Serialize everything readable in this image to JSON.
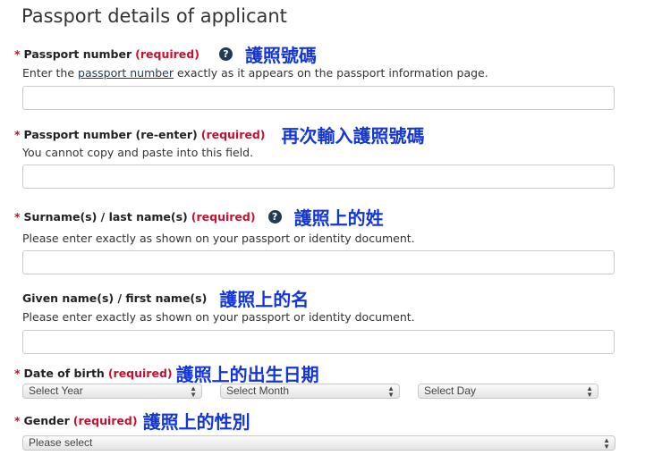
{
  "title": "Passport details of applicant",
  "required_text": "(required)",
  "asterisk": "*",
  "fields": [
    {
      "label": "Passport number",
      "annotation": "護照號碼",
      "hint_before": "Enter the ",
      "hint_link": "passport number",
      "hint_after": " exactly as it appears on the passport information page."
    },
    {
      "label": "Passport number (re-enter)",
      "annotation": "再次輸入護照號碼",
      "hint": "You cannot copy and paste into this field."
    },
    {
      "label": "Surname(s) / last name(s)",
      "annotation": "護照上的姓",
      "hint": "Please enter exactly as shown on your passport or identity document."
    },
    {
      "label": "Given name(s) / first name(s)",
      "annotation": "護照上的名",
      "hint": "Please enter exactly as shown on your passport or identity document."
    },
    {
      "label": "Date of birth",
      "annotation": "護照上的出生日期",
      "year": "Select Year",
      "month": "Select Month",
      "day": "Select Day"
    },
    {
      "label": "Gender",
      "annotation": "護照上的性別",
      "select": "Please select"
    }
  ],
  "help_glyph": "?"
}
